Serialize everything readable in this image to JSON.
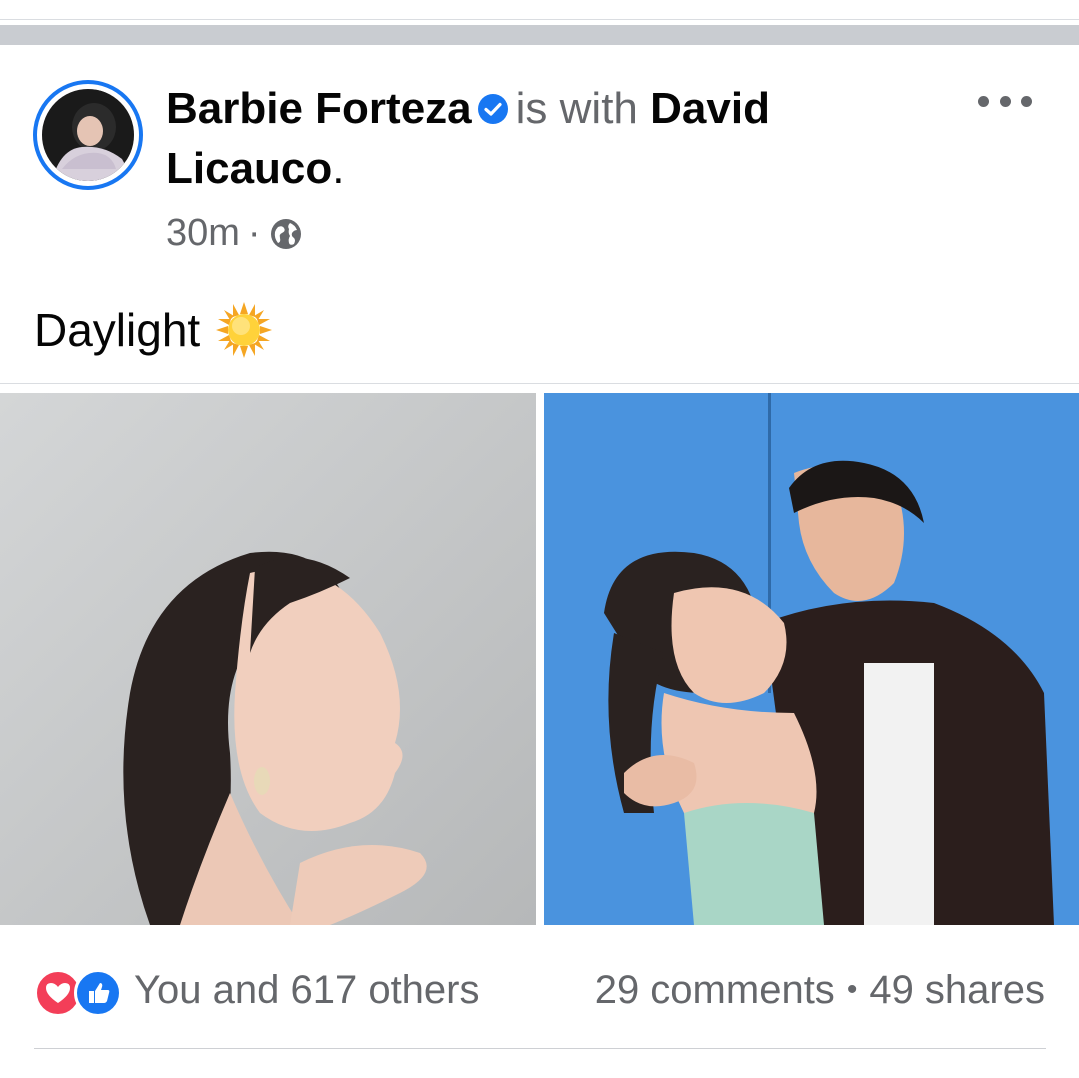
{
  "post": {
    "author": "Barbie Forteza",
    "with_text": "is with",
    "tagged": "David Licauco",
    "tagged_line1": "David",
    "tagged_line2": "Licauco",
    "period": ".",
    "time": "30m",
    "meta_dot": "·",
    "audience_icon": "globe-icon",
    "verified_icon": "verified-badge-icon",
    "more_icon": "more-options-icon",
    "caption": "Daylight",
    "caption_emoji": "sun-emoji-icon"
  },
  "footer": {
    "reactions_text": "You and 617 others",
    "reaction_icons": [
      "love-reaction-icon",
      "like-reaction-icon"
    ],
    "comments": "29 comments",
    "bullet": "•",
    "shares": "49 shares"
  },
  "colors": {
    "accent": "#1877f2",
    "love": "#f33e58",
    "secondary_text": "#65676b",
    "primary_text": "#050505",
    "right_photo_background": "#4a93de",
    "left_photo_background": "#c3c5c6"
  }
}
